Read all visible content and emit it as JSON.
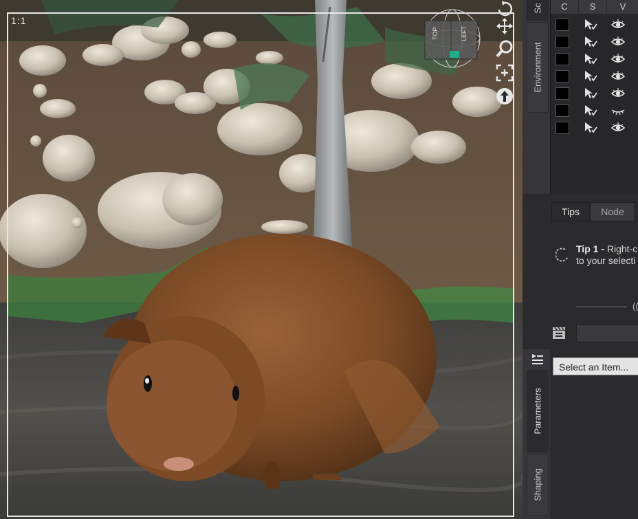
{
  "viewport": {
    "zoom_label": "1:1",
    "cube_top": "TOP",
    "cube_front": "LEFT"
  },
  "scene_panel": {
    "tab_label": "Scene",
    "tab_visible_text": "Sc",
    "columns": [
      "C",
      "S",
      "V"
    ],
    "rows": [
      {
        "visible": true
      },
      {
        "visible": true
      },
      {
        "visible": true
      },
      {
        "visible": true
      },
      {
        "visible": true
      },
      {
        "visible": false
      },
      {
        "visible": true
      }
    ]
  },
  "environment_tab": {
    "label": "Environment"
  },
  "tips_panel": {
    "tabs": [
      "Tips",
      "Node"
    ],
    "tip_title": "Tip 1 -",
    "tip_line1": " Right-c",
    "tip_line2": "to your selecti",
    "progress_suffix": "(("
  },
  "parameters_tab": {
    "label": "Parameters"
  },
  "shaping_tab": {
    "label": "Shaping"
  },
  "parameters_panel": {
    "select_placeholder": "Select an Item..."
  },
  "colors": {
    "accent_green": "#1fae86",
    "panel_bg": "#2b2b2e",
    "tab_bg": "#3a3a3e"
  }
}
